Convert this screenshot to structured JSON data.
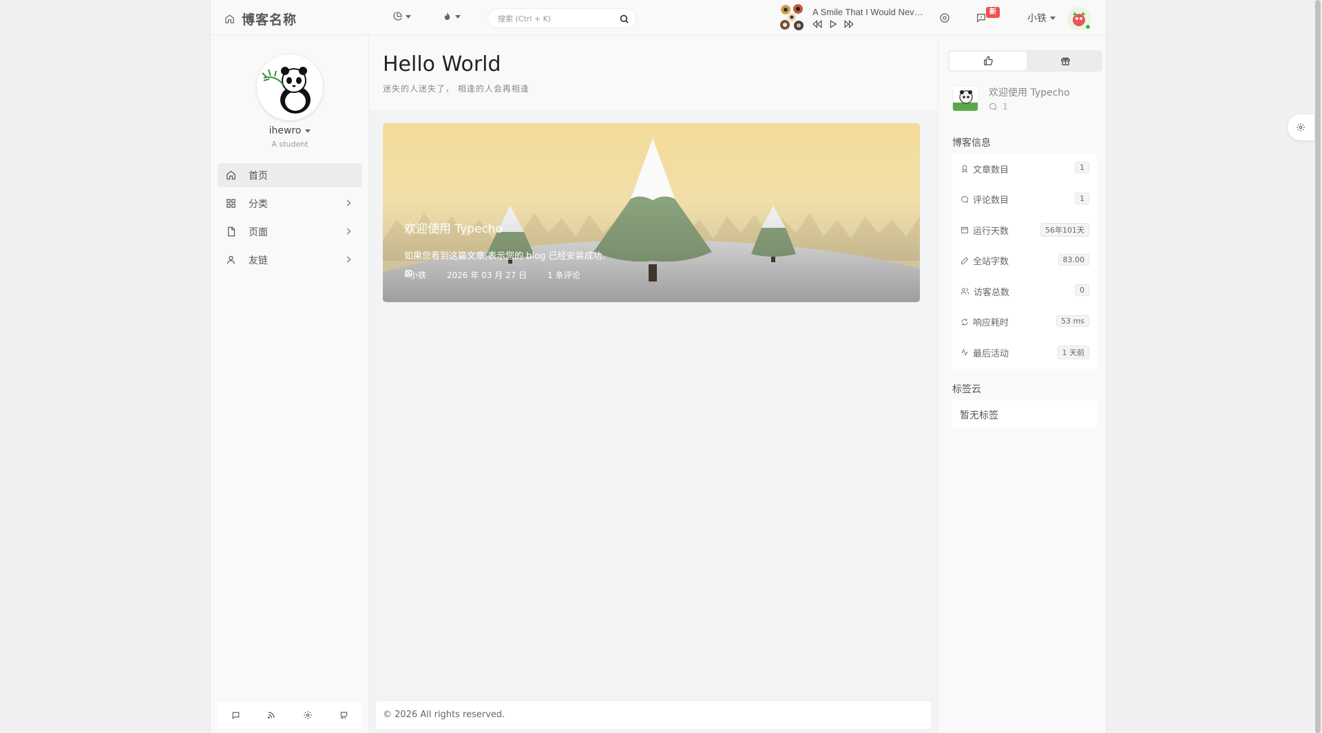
{
  "header": {
    "site_title": "博客名称",
    "search_placeholder": "搜索 (Ctrl + K)",
    "new_badge": "新",
    "user_name": "小铁"
  },
  "player": {
    "song_title": "A Smile That I Would Never Forget"
  },
  "profile": {
    "name": "ihewro",
    "subtitle": "A student"
  },
  "nav": {
    "items": [
      {
        "label": "首页",
        "icon": "home-icon",
        "active": true
      },
      {
        "label": "分类",
        "icon": "grid-icon",
        "has_children": true
      },
      {
        "label": "页面",
        "icon": "file-icon",
        "has_children": true
      },
      {
        "label": "友链",
        "icon": "user-icon",
        "has_children": true
      }
    ]
  },
  "sidebar_footer": {
    "icons": [
      "comment-icon",
      "rss-icon",
      "settings-icon",
      "github-icon"
    ]
  },
  "page": {
    "title": "Hello World",
    "subtitle": "迷失的人迷失了， 相逢的人会再相逢"
  },
  "post": {
    "title": "欢迎使用 Typecho",
    "excerpt": "如果您看到这篇文章,表示您的 blog 已经安装成功.",
    "author": "小铁",
    "date": "2026 年 03 月 27 日",
    "comments": "1 条评论"
  },
  "footer": {
    "copyright": "© 2026 All rights reserved."
  },
  "right": {
    "recent_title": "欢迎使用 Typecho",
    "recent_comment_count": "1",
    "blog_info_title": "博客信息",
    "stats": [
      {
        "label": "文章数目",
        "value": "1",
        "icon": "award-icon"
      },
      {
        "label": "评论数目",
        "value": "1",
        "icon": "comment-icon"
      },
      {
        "label": "运行天数",
        "value": "56年101天",
        "icon": "calendar-icon"
      },
      {
        "label": "全站字数",
        "value": "83.00",
        "icon": "pencil-icon"
      },
      {
        "label": "访客总数",
        "value": "0",
        "icon": "users-icon"
      },
      {
        "label": "响应耗时",
        "value": "53 ms",
        "icon": "refresh-icon"
      },
      {
        "label": "最后活动",
        "value": "1 天前",
        "icon": "activity-icon"
      }
    ],
    "tag_cloud_title": "标签云",
    "tag_cloud_empty": "暂无标签"
  },
  "colors": {
    "accent_red": "#f05050",
    "online_green": "#27c24c"
  }
}
